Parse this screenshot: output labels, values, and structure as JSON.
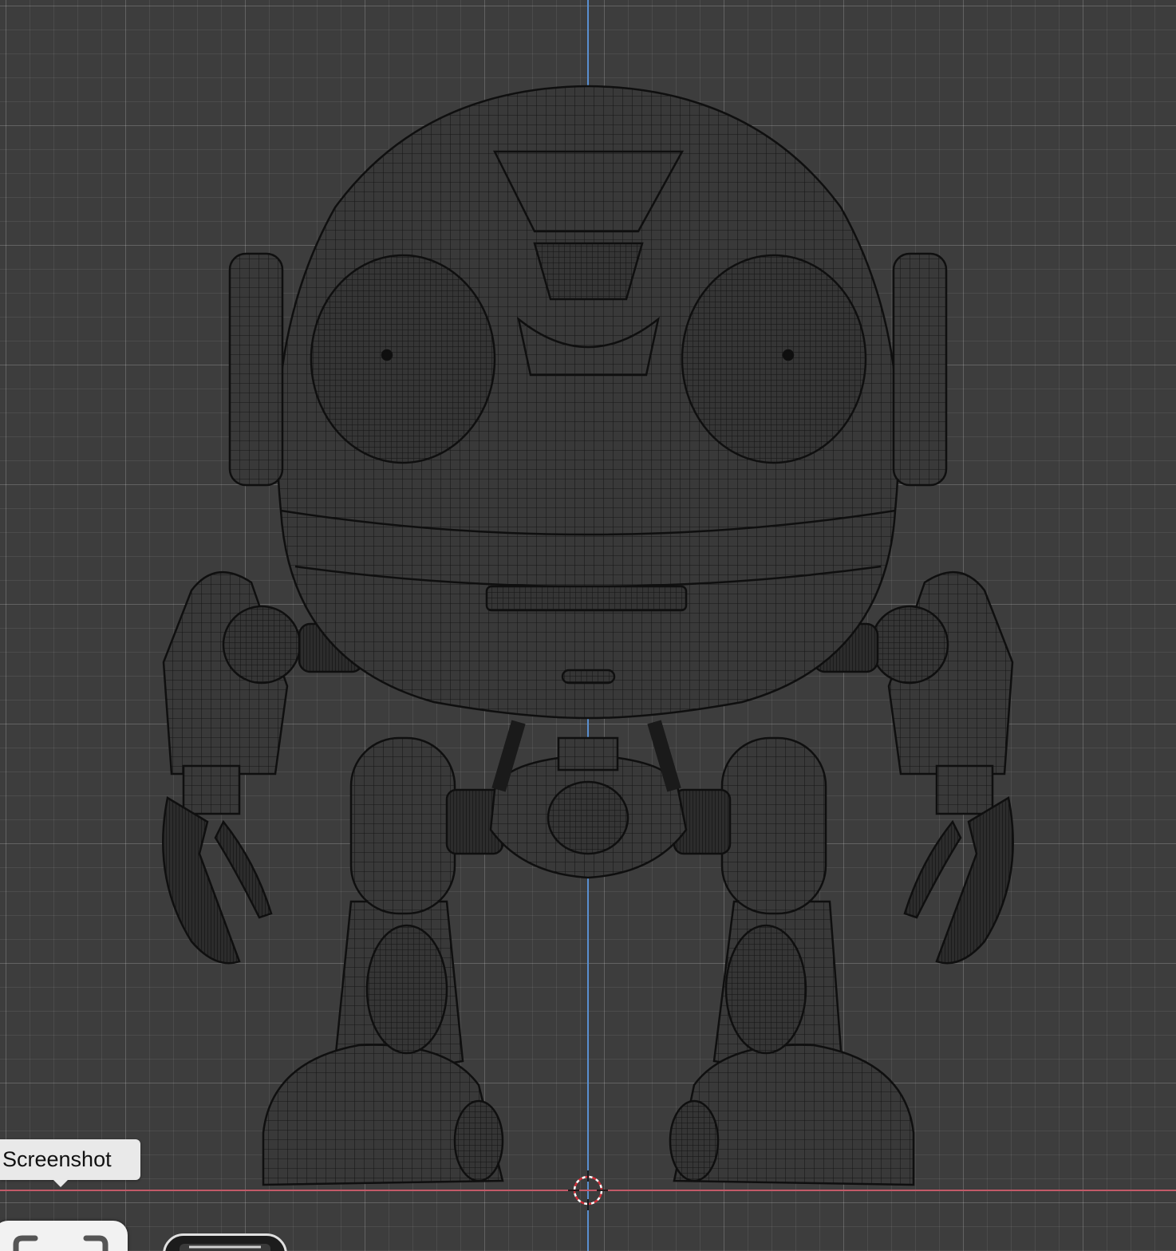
{
  "app": {
    "colors": {
      "viewport_bg": "#3d3d3d",
      "axis_z": "#5a8fd0",
      "axis_x": "#c25a68",
      "wire": "#111111",
      "mesh_fill": "#393939"
    }
  },
  "viewport": {
    "object": "robot-mesh-wireframe",
    "cursor_icon": "3d-cursor-icon"
  },
  "tooltip": {
    "text": "Screenshot"
  },
  "toolbar": {
    "screenshot_icon": "screenshot-frame-icon",
    "second_icon": "thumbnail-icon"
  }
}
